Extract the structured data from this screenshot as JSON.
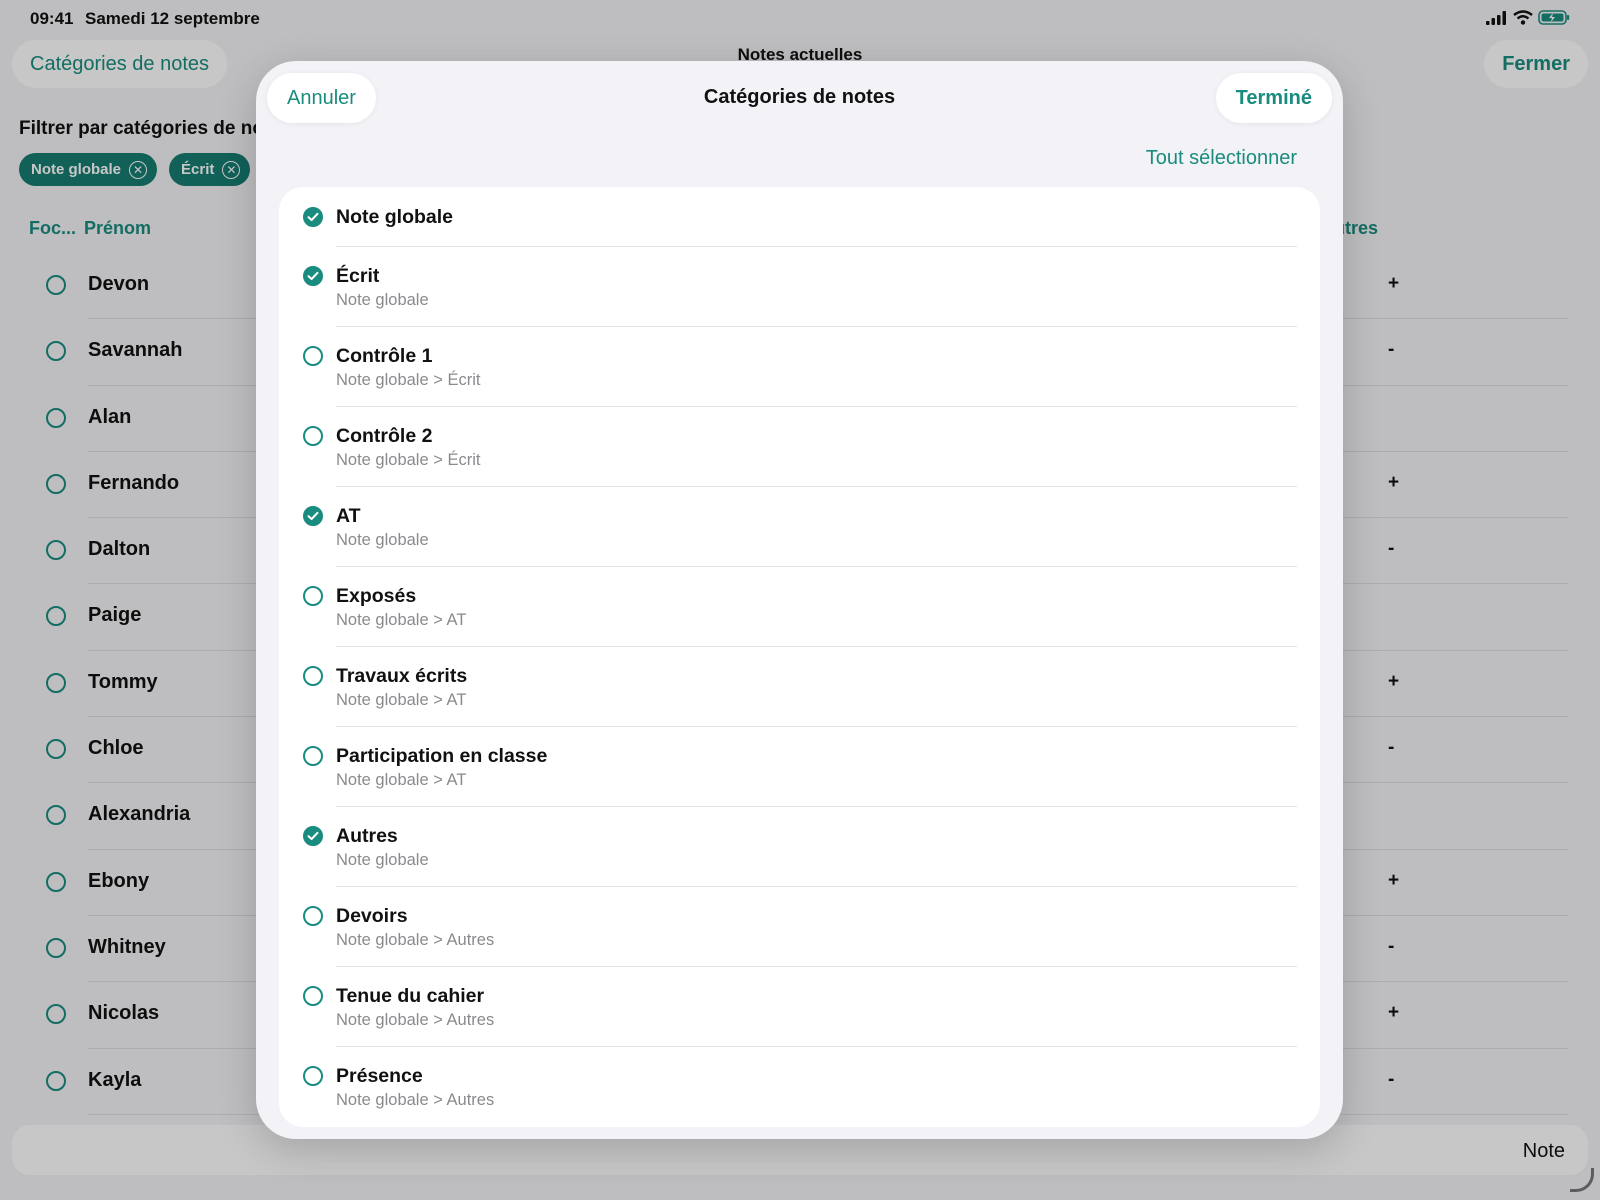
{
  "status_bar": {
    "time": "09:41",
    "date": "Samedi 12 septembre"
  },
  "background": {
    "back_button": "Catégories de notes",
    "center_title": "Notes actuelles",
    "close_button": "Fermer",
    "filter_label": "Filtrer par catégories de no",
    "chips": [
      "Note globale",
      "Écrit"
    ],
    "columns": {
      "focus": "Foc...",
      "first_name": "Prénom",
      "others": "utres"
    },
    "students": [
      {
        "name": "Devon",
        "tail": "+"
      },
      {
        "name": "Savannah",
        "tail": "-"
      },
      {
        "name": "Alan",
        "tail": ""
      },
      {
        "name": "Fernando",
        "tail": "+"
      },
      {
        "name": "Dalton",
        "tail": "-"
      },
      {
        "name": "Paige",
        "tail": ""
      },
      {
        "name": "Tommy",
        "tail": "+"
      },
      {
        "name": "Chloe",
        "tail": "-"
      },
      {
        "name": "Alexandria",
        "tail": ""
      },
      {
        "name": "Ebony",
        "tail": "+"
      },
      {
        "name": "Whitney",
        "tail": "-"
      },
      {
        "name": "Nicolas",
        "tail": "+"
      },
      {
        "name": "Kayla",
        "tail": "-"
      }
    ],
    "bottom_label": "Note"
  },
  "modal": {
    "cancel_label": "Annuler",
    "title": "Catégories de notes",
    "done_label": "Terminé",
    "select_all_label": "Tout sélectionner",
    "categories": [
      {
        "label": "Note globale",
        "path": "",
        "checked": true
      },
      {
        "label": "Écrit",
        "path": "Note globale",
        "checked": true
      },
      {
        "label": "Contrôle 1",
        "path": "Note globale > Écrit",
        "checked": false
      },
      {
        "label": "Contrôle 2",
        "path": "Note globale > Écrit",
        "checked": false
      },
      {
        "label": "AT",
        "path": "Note globale",
        "checked": true
      },
      {
        "label": "Exposés",
        "path": "Note globale > AT",
        "checked": false
      },
      {
        "label": "Travaux écrits",
        "path": "Note globale > AT",
        "checked": false
      },
      {
        "label": "Participation en classe",
        "path": "Note globale > AT",
        "checked": false
      },
      {
        "label": "Autres",
        "path": "Note globale",
        "checked": true
      },
      {
        "label": "Devoirs",
        "path": "Note globale > Autres",
        "checked": false
      },
      {
        "label": "Tenue du cahier",
        "path": "Note globale > Autres",
        "checked": false
      },
      {
        "label": "Présence",
        "path": "Note globale > Autres",
        "checked": false
      }
    ]
  },
  "colors": {
    "accent": "#1a8c7f",
    "chip": "#167d72",
    "secondary_text": "#8a8a8e"
  },
  "icons": [
    "signal-icon",
    "wifi-icon",
    "battery-icon",
    "checkmark-icon",
    "close-circle-icon",
    "resize-corner-icon"
  ]
}
